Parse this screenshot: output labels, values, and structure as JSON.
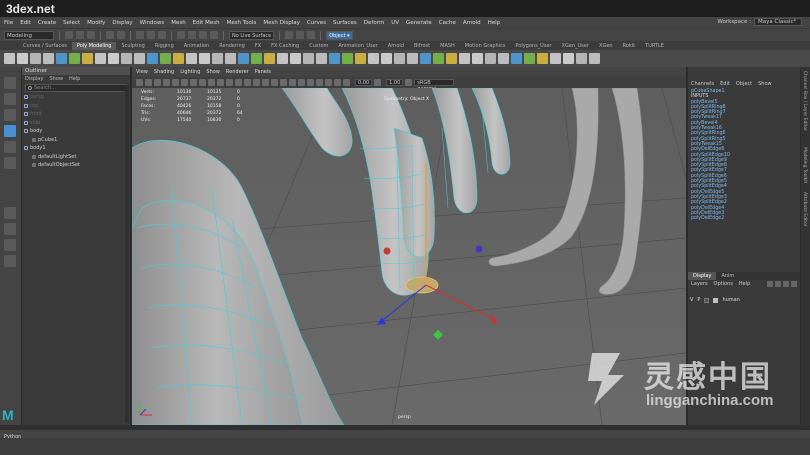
{
  "watermark": {
    "site": "3dex.net",
    "logo_cn": "灵感中国",
    "logo_en": "lingganchina.com"
  },
  "menubar": {
    "items": [
      "File",
      "Edit",
      "Create",
      "Select",
      "Modify",
      "Display",
      "Windows",
      "Mesh",
      "Edit Mesh",
      "Mesh Tools",
      "Mesh Display",
      "Curves",
      "Surfaces",
      "Deform",
      "UV",
      "Generate",
      "Cache",
      "Arnold",
      "Help"
    ],
    "workspace_label": "Workspace :",
    "workspace_value": "Maya Classic*"
  },
  "statusline": {
    "mode": "Modeling",
    "live_surface": "No Live Surface",
    "object_field": "Object ▾"
  },
  "shelf": {
    "tabs": [
      "Curves / Surfaces",
      "Poly Modeling",
      "Sculpting",
      "Rigging",
      "Animation",
      "Rendering",
      "FX",
      "FX Caching",
      "Custom",
      "Animation_User",
      "Arnold",
      "Bifrost",
      "MASH",
      "Motion Graphics",
      "Polygons_User",
      "XGen_User",
      "XGen",
      "Rokit",
      "TURTLE"
    ],
    "active_tab": "Poly Modeling",
    "icon_count": 46
  },
  "outliner": {
    "title": "Outliner",
    "menu": [
      "Display",
      "Show",
      "Help"
    ],
    "search_placeholder": "Search...",
    "items": [
      {
        "label": "persp",
        "faded": true,
        "indent": false
      },
      {
        "label": "top",
        "faded": true,
        "indent": false
      },
      {
        "label": "front",
        "faded": true,
        "indent": false
      },
      {
        "label": "side",
        "faded": true,
        "indent": false
      },
      {
        "label": "body",
        "faded": false,
        "indent": false
      },
      {
        "label": "pCube1",
        "faded": false,
        "indent": true
      },
      {
        "label": "body1",
        "faded": false,
        "indent": false
      },
      {
        "label": "defaultLightSet",
        "faded": false,
        "indent": true
      },
      {
        "label": "defaultObjectSet",
        "faded": false,
        "indent": true
      }
    ]
  },
  "viewport": {
    "menu": [
      "View",
      "Shading",
      "Lighting",
      "Show",
      "Renderer",
      "Panels"
    ],
    "gamma_value": "0.00",
    "exposure_value": "1.00",
    "color_space": "sRGB gamma",
    "hud": [
      {
        "label": "Verts:",
        "a": "10136",
        "b": "10135",
        "c": "0"
      },
      {
        "label": "Edges:",
        "a": "20737",
        "b": "20372",
        "c": "0"
      },
      {
        "label": "Faces:",
        "a": "40426",
        "b": "10158",
        "c": "0"
      },
      {
        "label": "Tris:",
        "a": "40646",
        "b": "20372",
        "c": "64"
      },
      {
        "label": "UVs:",
        "a": "17540",
        "b": "10830",
        "c": "0"
      }
    ],
    "symmetry": "Symmetry: Object X",
    "camera": "persp"
  },
  "channelbox": {
    "menu": [
      "Channels",
      "Edit",
      "Object",
      "Show"
    ],
    "nodes": [
      "pCubeShape1",
      "INPUTS",
      "polyBevel5",
      "polySplitRing8",
      "polySplitRing7",
      "polyTweak17",
      "polyBevel4",
      "polyTweak16",
      "polySplitRing6",
      "polySplitRing5",
      "polyTweak15",
      "polyDelEdge6",
      "polySplitEdge10",
      "polySplitEdge9",
      "polySplitEdge8",
      "polySplitEdge7",
      "polySplitEdge6",
      "polySplitEdge5",
      "polySplitEdge4",
      "polyDelEdge5",
      "polySplitEdge3",
      "polySplitEdge2",
      "polyDelEdge4",
      "polyDelEdge3",
      "polyDelEdge2"
    ],
    "layer_tabs": [
      "Display",
      "Anim"
    ],
    "layer_active": "Display",
    "layer_menu": [
      "Layers",
      "Options",
      "Help"
    ],
    "layer_v": "V",
    "layer_p": "P",
    "layer_name": "human"
  },
  "side_tabs": [
    "Channel Box / Layer Editor",
    "Modeling Toolkit",
    "Attribute Editor"
  ],
  "bottom": {
    "language": "Python"
  },
  "colors": {
    "accent": "#4a8fd4",
    "wireframe": "#3fd0e0",
    "maya_logo": "#27b5c9"
  }
}
